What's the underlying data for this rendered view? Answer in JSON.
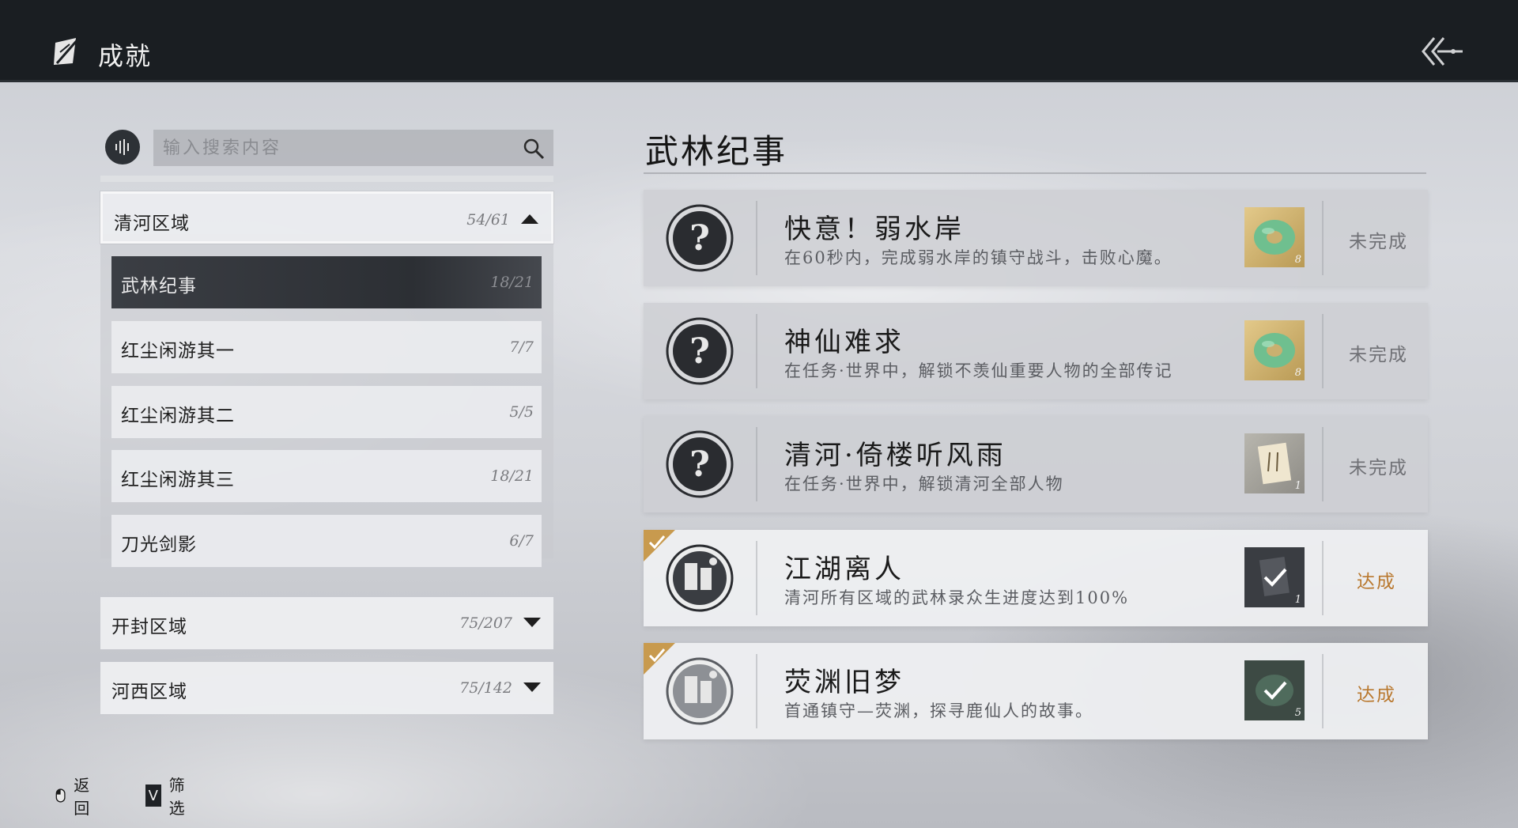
{
  "header": {
    "title": "成就"
  },
  "search": {
    "placeholder": "输入搜索内容"
  },
  "regions": [
    {
      "name": "清河区域",
      "count": "54/61",
      "expanded": true,
      "subitems": [
        {
          "name": "武林纪事",
          "count": "18/21",
          "active": true
        },
        {
          "name": "红尘闲游其一",
          "count": "7/7"
        },
        {
          "name": "红尘闲游其二",
          "count": "5/5"
        },
        {
          "name": "红尘闲游其三",
          "count": "18/21"
        },
        {
          "name": "刀光剑影",
          "count": "6/7"
        }
      ]
    },
    {
      "name": "开封区域",
      "count": "75/207",
      "expanded": false
    },
    {
      "name": "河西区域",
      "count": "75/142",
      "expanded": false
    }
  ],
  "section": {
    "title": "武林纪事"
  },
  "achievements": [
    {
      "title": "快意！弱水岸",
      "desc": "在60秒内，完成弱水岸的镇守战斗，击败心魔。",
      "reward_icon": "jade-ring-icon",
      "reward_count": "8",
      "status": "未完成",
      "done": false
    },
    {
      "title": "神仙难求",
      "desc": "在任务·世界中，解锁不羡仙重要人物的全部传记",
      "reward_icon": "jade-ring-icon",
      "reward_count": "8",
      "status": "未完成",
      "done": false
    },
    {
      "title": "清河·倚楼听风雨",
      "desc": "在任务·世界中，解锁清河全部人物",
      "reward_icon": "scroll-icon",
      "reward_count": "1",
      "status": "未完成",
      "done": false
    },
    {
      "title": "江湖离人",
      "desc": "清河所有区域的武林录众生进度达到100%",
      "reward_icon": "scroll-claimed-icon",
      "reward_count": "1",
      "status": "达成",
      "done": true
    },
    {
      "title": "荧渊旧梦",
      "desc": "首通镇守—荧渊，探寻鹿仙人的故事。",
      "reward_icon": "jade-claimed-icon",
      "reward_count": "5",
      "status": "达成",
      "done": true
    }
  ],
  "footer": {
    "back_label": "返回",
    "filter_key": "V",
    "filter_label": "筛选"
  },
  "colors": {
    "topbar": "#1a1e22",
    "done_status": "#b9782e",
    "pending_status": "#6f7075",
    "active_item": "#2c2f34"
  }
}
